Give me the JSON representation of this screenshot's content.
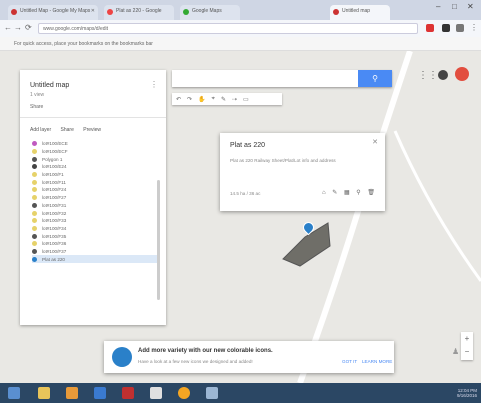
{
  "browser": {
    "tabs": [
      {
        "label": "Untitled Map - Google My Maps"
      },
      {
        "label": "Plat as 220 - Google"
      },
      {
        "label": "Google Maps"
      },
      {
        "label": "Untitled map"
      }
    ],
    "url": "www.google.com/maps/d/edit",
    "infobar_text": "For quick access, place your bookmarks on the bookmarks bar"
  },
  "panel": {
    "title": "Untitled map",
    "subtitle": "1 view",
    "share_label": "Share",
    "actions": [
      "Add layer",
      "Share",
      "Preview"
    ],
    "layers": [
      {
        "label": "lot#100/ECE",
        "color": "#c05ac0"
      },
      {
        "label": "lot#100/ECF",
        "color": "#e6d26a"
      },
      {
        "label": "Polygon 1",
        "color": "#555555"
      },
      {
        "label": "lot#100/E24",
        "color": "#444444"
      },
      {
        "label": "lot#100/F1",
        "color": "#e6d26a"
      },
      {
        "label": "lot#100/F11",
        "color": "#e6d26a"
      },
      {
        "label": "lot#100/F24",
        "color": "#e6d26a"
      },
      {
        "label": "lot#100/F27",
        "color": "#e6d26a"
      },
      {
        "label": "lot#100/F31",
        "color": "#555555"
      },
      {
        "label": "lot#100/F32",
        "color": "#e6d26a"
      },
      {
        "label": "lot#100/F33",
        "color": "#e6d26a"
      },
      {
        "label": "lot#100/F34",
        "color": "#e6d26a"
      },
      {
        "label": "lot#100/F35",
        "color": "#555555"
      },
      {
        "label": "lot#100/F36",
        "color": "#e6d26a"
      },
      {
        "label": "lot#100/F37",
        "color": "#555555"
      },
      {
        "label": "Plat as 220",
        "color": "#2a80c9",
        "selected": true
      }
    ]
  },
  "search": {
    "placeholder": "",
    "button_icon": "search-icon"
  },
  "toolbar": {
    "items": [
      "↶",
      "↷",
      "✋",
      "⌖",
      "✎",
      "⇢",
      "▭"
    ]
  },
  "popup": {
    "title": "Plat as 220",
    "description": "Plat as 220 Railway Sheet/Plat/Lot info and address",
    "meta": "14.5 ha / 36 ac",
    "actions": [
      "⌂",
      "✎",
      "▦",
      "⚲",
      "🗑"
    ]
  },
  "banner": {
    "title": "Add more variety with our new colorable icons.",
    "text": "Have a look at a few new icons we designed and added!",
    "got_it": "GOT IT",
    "learn_more": "LEARN MORE"
  },
  "taskbar": {
    "time": "12:04 PM",
    "date": "9/16/2016"
  },
  "colors": {
    "accent": "#4a8af4",
    "marker": "#2a80c9",
    "polygon": "#6f6e68"
  }
}
